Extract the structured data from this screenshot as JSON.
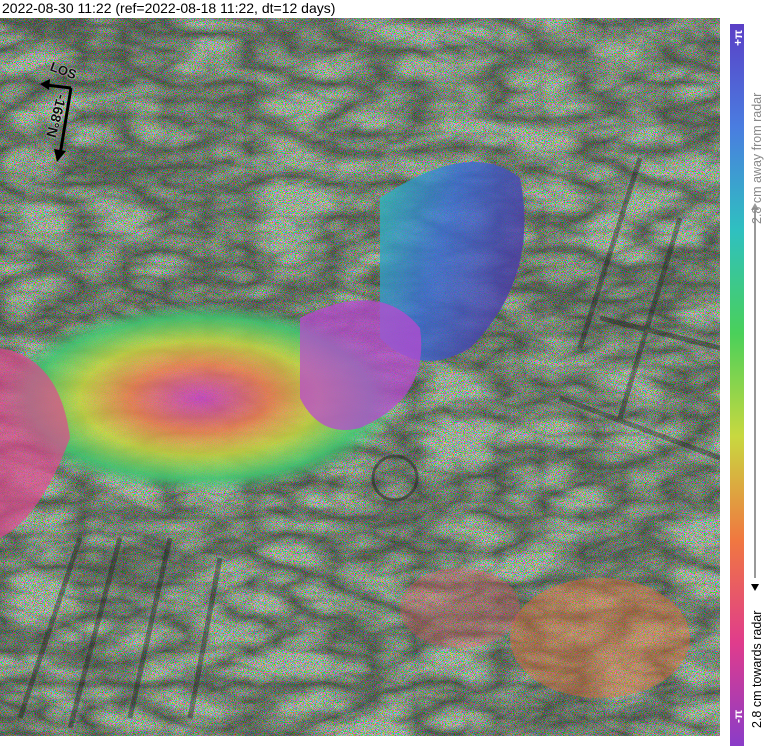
{
  "title": "2022-08-30 11:22 (ref=2022-08-18 11:22, dt=12 days)",
  "compass": {
    "los_label": "LOS",
    "heading_label": "-168°N"
  },
  "colorbar": {
    "top_label": "+π",
    "bottom_label": "-π",
    "away_label": "2.8 cm away from radar",
    "towards_label": "2.8 cm towards radar",
    "colors": [
      "#5a3fc6",
      "#4a7de0",
      "#2fc0c0",
      "#4ad05a",
      "#c8d840",
      "#f07840",
      "#e03c8c",
      "#8a3cc8"
    ]
  }
}
